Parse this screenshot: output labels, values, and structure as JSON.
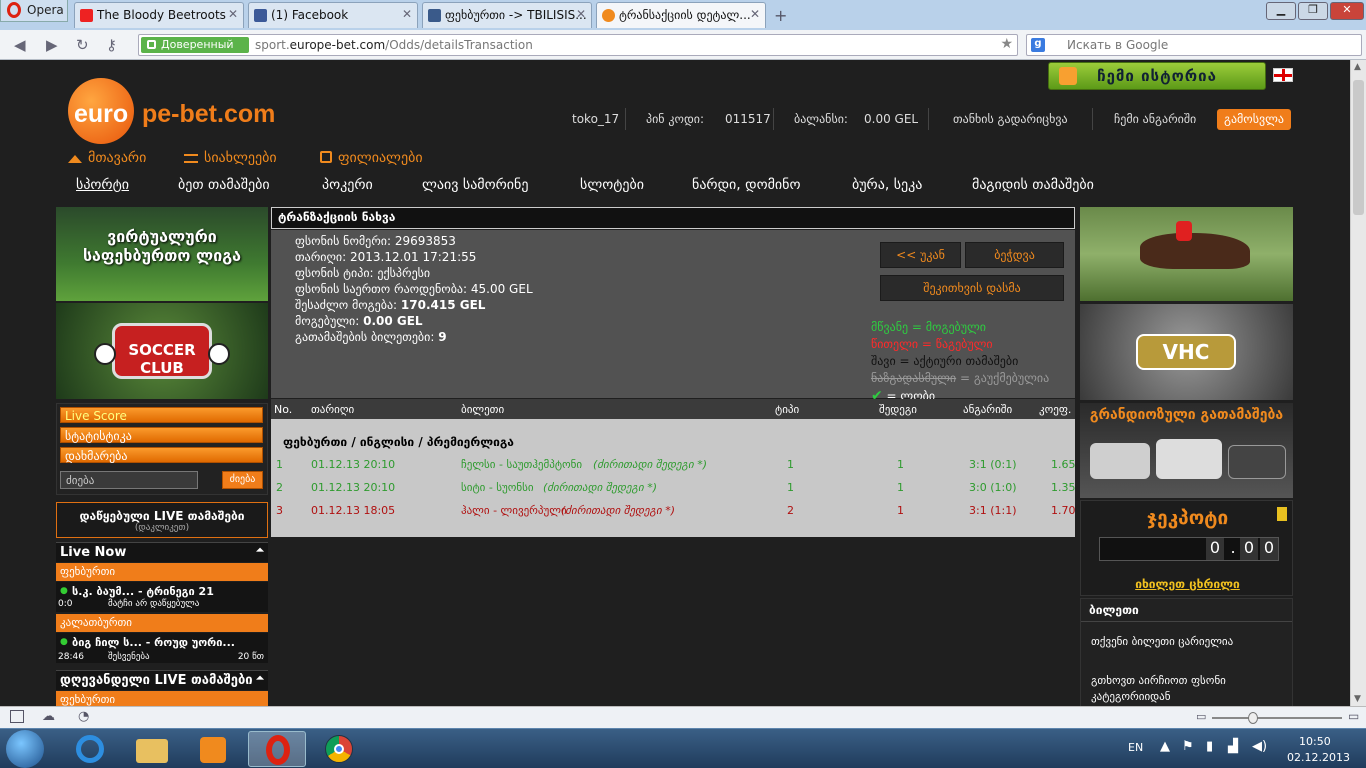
{
  "browser": {
    "opera_label": "Opera",
    "tabs": [
      {
        "title": "The Bloody Beetroots",
        "icon": "youtube-icon"
      },
      {
        "title": "(1) Facebook",
        "icon": "facebook-icon"
      },
      {
        "title": "ფეხბურთი -> TBILISIS...",
        "icon": "page-icon"
      },
      {
        "title": "ტრანსაქციის დეტალ...",
        "icon": "europebet-icon"
      }
    ],
    "secure_label": "Доверенный",
    "url_prefix": "sport.",
    "url_domain": "europe-bet.com",
    "url_path": "/Odds/detailsTransaction",
    "search_placeholder": "Искать в Google"
  },
  "site": {
    "logo_part1": "euro",
    "logo_part2": "pe-bet.com",
    "history_button": "ჩემი ისტორია",
    "user": {
      "username": "toko_17",
      "pin_label": "პინ კოდი:",
      "pin_value": "011517",
      "balance_label": "ბალანსი:",
      "balance_value": "0.00 GEL",
      "deposit_link": "თანხის გადარიცხვა",
      "account_link": "ჩემი ანგარიში",
      "logout_button": "გამოსვლა"
    },
    "main_nav": [
      "მთავარი",
      "სიახლეები",
      "ფილიალები"
    ],
    "sec_nav": [
      "სპორტი",
      "ბეთ თამაშები",
      "პოკერი",
      "ლაივ სამორინე",
      "სლოტები",
      "ნარდი, დომინო",
      "ბურა, სეკა",
      "მაგიდის თამაშები"
    ]
  },
  "left": {
    "banner1_text": "ვირტუალური საფეხბურთო ლიგა",
    "banner2_text": "SOCCER CLUB",
    "menu": [
      "Live Score",
      "სტატისტიკა",
      "დახმარება"
    ],
    "search_placeholder": "ძიება",
    "search_button": "ძიება",
    "live_box_title": "დაწყებული LIVE თამაშები",
    "live_box_sub": "(დაკლიკეთ)",
    "live_now": "Live Now",
    "live": [
      {
        "category": "ფეხბურთი",
        "match": "ს.კ. ბაუმ... - ტრინეგი 21",
        "score": "0:0",
        "status": "მატჩი არ დაწყებულა",
        "time": ""
      },
      {
        "category": "კალათბურთი",
        "match": "ბიგ ჩილ ს... - როუდ უორი...",
        "score": "28:46",
        "status": "შესვენება",
        "time": "20 წთ"
      }
    ],
    "upcoming_title": "დღევანდელი LIVE თამაშები",
    "upcoming_category": "ფეხბურთი"
  },
  "ticket": {
    "header": "ტრანზაქციის ნახვა",
    "lines": [
      {
        "label": "ფსონის ნომერი: ",
        "value": "29693853"
      },
      {
        "label": "თარიღი: ",
        "value": "2013.12.01 17:21:55"
      },
      {
        "label": "ფსონის ტიპი: ",
        "value": "ექსპრესი"
      },
      {
        "label": "ფსონის საერთო რაოდენობა: ",
        "value": "45.00 GEL"
      },
      {
        "label": "შესაძლო მოგება: ",
        "value": "170.415 GEL"
      },
      {
        "label": "მოგებული: ",
        "value": "0.00 GEL"
      },
      {
        "label": "გათამაშების ბილეთები: ",
        "value": "9"
      }
    ],
    "back_button": "<< უკან",
    "print_button": "ბეჭდვა",
    "complaint_button": "შეკითხვის დასმა",
    "legend": [
      {
        "key": "მწვანე",
        "desc": " = მოგებული",
        "color": "#2ecc40"
      },
      {
        "key": "წითელი",
        "desc": " = წაგებული",
        "color": "#ff2a2a"
      },
      {
        "key": "შავი",
        "desc": " = აქტიური თამაშები",
        "color": "#111111"
      },
      {
        "key": "ნაზგადასმული",
        "desc": " = გაუქმებულია",
        "color": "#9a9a9a"
      },
      {
        "key": "",
        "desc": " = ლობი",
        "color": "#2ecc40"
      }
    ],
    "columns": [
      "No.",
      "თარიღი",
      "ბილეთი",
      "ტიპი",
      "შედეგი",
      "ანგარიში",
      "კოეფ."
    ],
    "league": "ფეხბურთი / ინგლისი / პრემიერლიგა",
    "rows": [
      {
        "no": "1",
        "date": "01.12.13 20:10",
        "match": "ჩელსი - საუთჰემპტონი",
        "note": "(ძირითადი შედეგი *)",
        "type": "1",
        "result": "1",
        "score": "3:1 (0:1)",
        "odds": "1.65",
        "color": "#2e9b2e"
      },
      {
        "no": "2",
        "date": "01.12.13 20:10",
        "match": "სიტი - სუონსი",
        "note": "(ძირითადი შედეგი *)",
        "type": "1",
        "result": "1",
        "score": "3:0 (1:0)",
        "odds": "1.35",
        "color": "#2e9b2e"
      },
      {
        "no": "3",
        "date": "01.12.13 18:05",
        "match": "ჰალი - ლივერპული",
        "note": "(ძირითადი შედეგი *)",
        "type": "2",
        "result": "1",
        "score": "3:1 (1:1)",
        "odds": "1.70",
        "color": "#b01010"
      }
    ]
  },
  "right": {
    "vhc_text": "VHC",
    "grand_title": "გრანდიოზული გათამაშება",
    "jackpot_title": "ჯეკპოტი",
    "jackpot_digits": [
      "0",
      ".",
      "0",
      "0"
    ],
    "jackpot_link": "იხილეთ ცხრილი",
    "ticket_title": "ბილეთი",
    "ticket_empty": "თქვენი ბილეთი ცარიელია",
    "ticket_hint": "გთხოვთ აირჩიოთ ფსონი კატეგორიიდან"
  },
  "taskbar": {
    "lang": "EN",
    "time": "10:50",
    "date": "02.12.2013"
  }
}
